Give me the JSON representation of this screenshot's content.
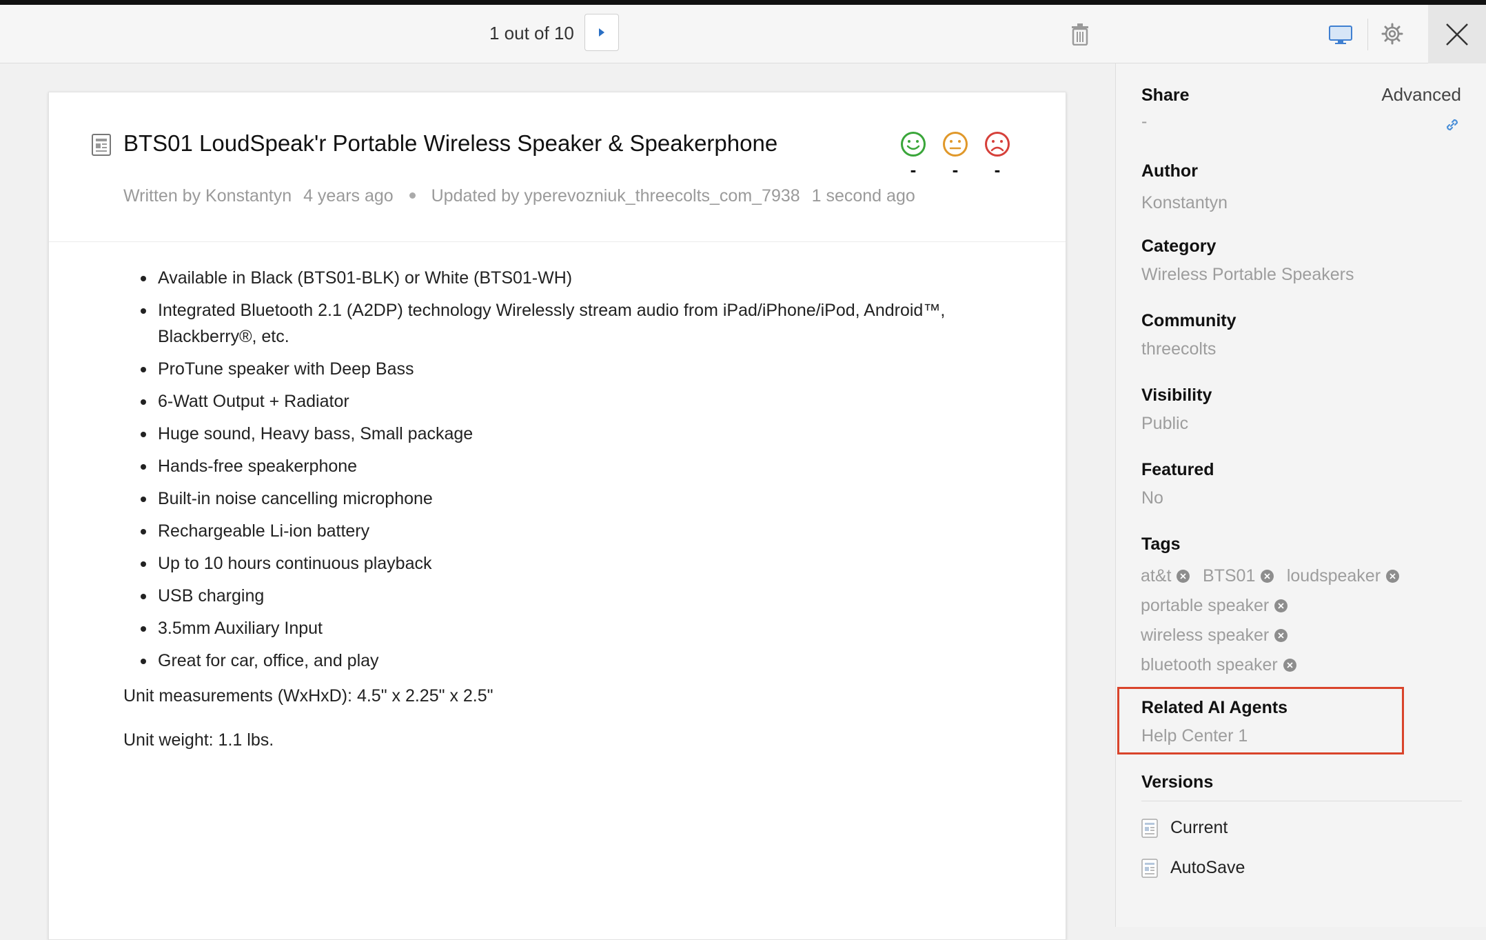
{
  "toolbar": {
    "pager_text": "1 out of 10",
    "icons": {
      "next": "triangle-right-icon",
      "delete": "trash-icon",
      "preview": "monitor-icon",
      "settings": "gear-icon",
      "close": "close-icon"
    }
  },
  "article": {
    "title": "BTS01 LoudSpeak'r Portable Wireless Speaker & Speakerphone",
    "written_by": "Written by Konstantyn",
    "written_ago": "4 years ago",
    "updated_by": "Updated by yperevozniuk_threecolts_com_7938",
    "updated_ago": "1 second ago",
    "ratings": [
      {
        "icon": "happy-face-icon",
        "color": "#3aa63a",
        "count": "-"
      },
      {
        "icon": "neutral-face-icon",
        "color": "#e0982a",
        "count": "-"
      },
      {
        "icon": "sad-face-icon",
        "color": "#d6403a",
        "count": "-"
      }
    ],
    "bullets": [
      "Available in Black (BTS01-BLK) or White (BTS01-WH)",
      "Integrated Bluetooth 2.1 (A2DP) technology Wirelessly stream audio from iPad/iPhone/iPod, Android™, Blackberry®, etc.",
      "ProTune speaker with Deep Bass",
      "6-Watt Output + Radiator",
      "Huge sound, Heavy bass, Small package",
      "Hands-free speakerphone",
      "Built-in noise cancelling microphone",
      "Rechargeable Li-ion battery",
      "Up to 10 hours continuous playback",
      "USB charging",
      "3.5mm Auxiliary Input",
      "Great for car, office, and play"
    ],
    "measurements": "Unit measurements (WxHxD): 4.5\" x 2.25\" x 2.5\"",
    "weight": "Unit weight: 1.1 lbs."
  },
  "sidebar": {
    "share_label": "Share",
    "share_value": "-",
    "advanced_label": "Advanced",
    "author_label": "Author",
    "author_value": "Konstantyn",
    "category_label": "Category",
    "category_value": "Wireless Portable Speakers",
    "community_label": "Community",
    "community_value": "threecolts",
    "visibility_label": "Visibility",
    "visibility_value": "Public",
    "featured_label": "Featured",
    "featured_value": "No",
    "tags_label": "Tags",
    "tags": [
      "at&t",
      "BTS01",
      "loudspeaker",
      "portable speaker",
      "wireless speaker",
      "bluetooth speaker"
    ],
    "related_label": "Related AI Agents",
    "related_value": "Help Center 1",
    "versions_label": "Versions",
    "versions": [
      "Current",
      "AutoSave"
    ],
    "highlight_color": "#d9442b"
  }
}
